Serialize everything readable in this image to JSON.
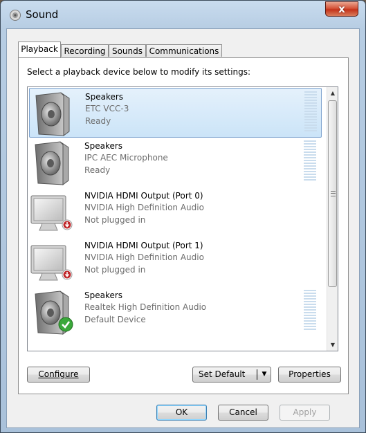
{
  "window": {
    "title": "Sound",
    "close_label": "x"
  },
  "tabs": [
    {
      "label": "Playback",
      "active": true
    },
    {
      "label": "Recording",
      "active": false
    },
    {
      "label": "Sounds",
      "active": false
    },
    {
      "label": "Communications",
      "active": false
    }
  ],
  "instruction": "Select a playback device below to modify its settings:",
  "devices": [
    {
      "name": "Speakers",
      "description": "ETC VCC-3",
      "status": "Ready",
      "icon": "speaker-icon",
      "badge": null,
      "selected": true,
      "meter": true
    },
    {
      "name": "Speakers",
      "description": "IPC AEC Microphone",
      "status": "Ready",
      "icon": "speaker-icon",
      "badge": null,
      "selected": false,
      "meter": true
    },
    {
      "name": "NVIDIA HDMI Output (Port 0)",
      "description": "NVIDIA High Definition Audio",
      "status": "Not plugged in",
      "icon": "monitor-icon",
      "badge": "unplugged",
      "selected": false,
      "meter": false
    },
    {
      "name": "NVIDIA HDMI Output (Port 1)",
      "description": "NVIDIA High Definition Audio",
      "status": "Not plugged in",
      "icon": "monitor-icon",
      "badge": "unplugged",
      "selected": false,
      "meter": false
    },
    {
      "name": "Speakers",
      "description": "Realtek High Definition Audio",
      "status": "Default Device",
      "icon": "speaker-icon",
      "badge": "default",
      "selected": false,
      "meter": true
    }
  ],
  "buttons": {
    "configure": "Configure",
    "set_default": "Set Default",
    "properties": "Properties",
    "ok": "OK",
    "cancel": "Cancel",
    "apply": "Apply"
  },
  "colors": {
    "selection": "#cbe4f8",
    "default_badge": "#3aa83a",
    "unplugged_badge": "#c0282b"
  }
}
